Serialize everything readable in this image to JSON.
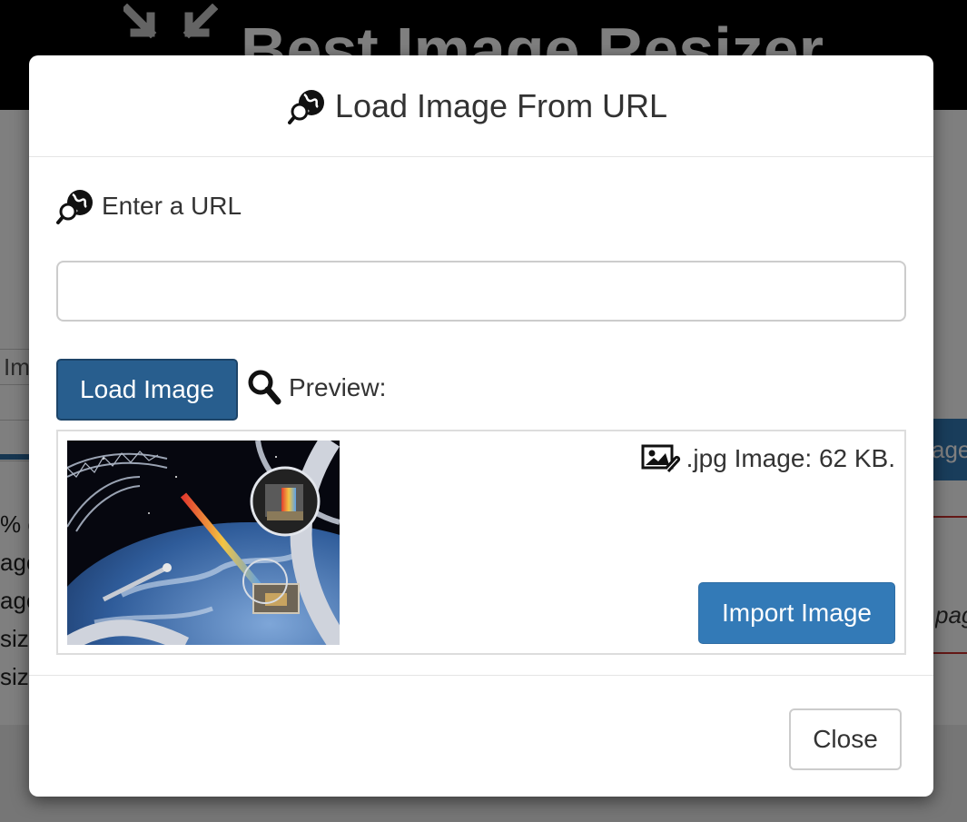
{
  "background": {
    "logo_text": "Best Image Resizer",
    "left_tab_text": "Im",
    "stat_lines": [
      "% c",
      "age",
      "age",
      "size",
      "size"
    ],
    "right_button_text": "age",
    "right_italic_text": "pag"
  },
  "modal": {
    "title": "Load Image From URL",
    "url_label": "Enter a URL",
    "url_input": {
      "value": "",
      "placeholder": ""
    },
    "load_button": "Load Image",
    "preview_label": "Preview:",
    "file_info": ".jpg Image: 62 KB.",
    "import_button": "Import Image",
    "close_button": "Close"
  },
  "icons": {
    "title": "globe-search-icon",
    "url_label": "globe-search-icon",
    "preview": "magnifier-icon",
    "file": "image-attachment-icon",
    "logo": "compress-arrows-icon"
  },
  "colors": {
    "primary_dark": "#285e8e",
    "primary": "#337ab7",
    "danger_line": "#c9302c"
  }
}
